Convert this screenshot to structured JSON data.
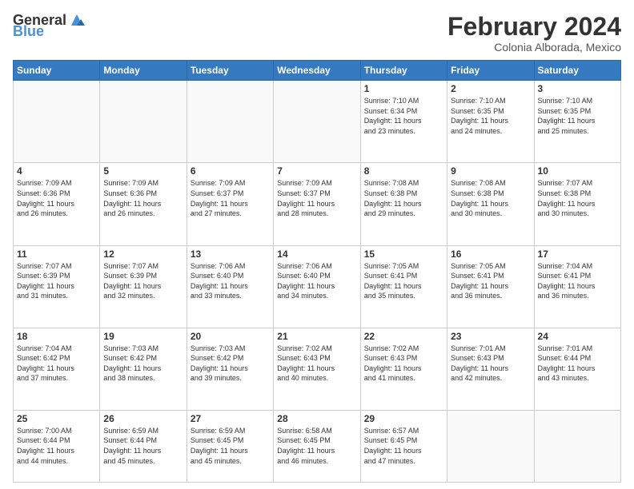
{
  "header": {
    "logo_general": "General",
    "logo_blue": "Blue",
    "month": "February 2024",
    "location": "Colonia Alborada, Mexico"
  },
  "weekdays": [
    "Sunday",
    "Monday",
    "Tuesday",
    "Wednesday",
    "Thursday",
    "Friday",
    "Saturday"
  ],
  "weeks": [
    [
      {
        "day": "",
        "info": ""
      },
      {
        "day": "",
        "info": ""
      },
      {
        "day": "",
        "info": ""
      },
      {
        "day": "",
        "info": ""
      },
      {
        "day": "1",
        "info": "Sunrise: 7:10 AM\nSunset: 6:34 PM\nDaylight: 11 hours\nand 23 minutes."
      },
      {
        "day": "2",
        "info": "Sunrise: 7:10 AM\nSunset: 6:35 PM\nDaylight: 11 hours\nand 24 minutes."
      },
      {
        "day": "3",
        "info": "Sunrise: 7:10 AM\nSunset: 6:35 PM\nDaylight: 11 hours\nand 25 minutes."
      }
    ],
    [
      {
        "day": "4",
        "info": "Sunrise: 7:09 AM\nSunset: 6:36 PM\nDaylight: 11 hours\nand 26 minutes."
      },
      {
        "day": "5",
        "info": "Sunrise: 7:09 AM\nSunset: 6:36 PM\nDaylight: 11 hours\nand 26 minutes."
      },
      {
        "day": "6",
        "info": "Sunrise: 7:09 AM\nSunset: 6:37 PM\nDaylight: 11 hours\nand 27 minutes."
      },
      {
        "day": "7",
        "info": "Sunrise: 7:09 AM\nSunset: 6:37 PM\nDaylight: 11 hours\nand 28 minutes."
      },
      {
        "day": "8",
        "info": "Sunrise: 7:08 AM\nSunset: 6:38 PM\nDaylight: 11 hours\nand 29 minutes."
      },
      {
        "day": "9",
        "info": "Sunrise: 7:08 AM\nSunset: 6:38 PM\nDaylight: 11 hours\nand 30 minutes."
      },
      {
        "day": "10",
        "info": "Sunrise: 7:07 AM\nSunset: 6:38 PM\nDaylight: 11 hours\nand 30 minutes."
      }
    ],
    [
      {
        "day": "11",
        "info": "Sunrise: 7:07 AM\nSunset: 6:39 PM\nDaylight: 11 hours\nand 31 minutes."
      },
      {
        "day": "12",
        "info": "Sunrise: 7:07 AM\nSunset: 6:39 PM\nDaylight: 11 hours\nand 32 minutes."
      },
      {
        "day": "13",
        "info": "Sunrise: 7:06 AM\nSunset: 6:40 PM\nDaylight: 11 hours\nand 33 minutes."
      },
      {
        "day": "14",
        "info": "Sunrise: 7:06 AM\nSunset: 6:40 PM\nDaylight: 11 hours\nand 34 minutes."
      },
      {
        "day": "15",
        "info": "Sunrise: 7:05 AM\nSunset: 6:41 PM\nDaylight: 11 hours\nand 35 minutes."
      },
      {
        "day": "16",
        "info": "Sunrise: 7:05 AM\nSunset: 6:41 PM\nDaylight: 11 hours\nand 36 minutes."
      },
      {
        "day": "17",
        "info": "Sunrise: 7:04 AM\nSunset: 6:41 PM\nDaylight: 11 hours\nand 36 minutes."
      }
    ],
    [
      {
        "day": "18",
        "info": "Sunrise: 7:04 AM\nSunset: 6:42 PM\nDaylight: 11 hours\nand 37 minutes."
      },
      {
        "day": "19",
        "info": "Sunrise: 7:03 AM\nSunset: 6:42 PM\nDaylight: 11 hours\nand 38 minutes."
      },
      {
        "day": "20",
        "info": "Sunrise: 7:03 AM\nSunset: 6:42 PM\nDaylight: 11 hours\nand 39 minutes."
      },
      {
        "day": "21",
        "info": "Sunrise: 7:02 AM\nSunset: 6:43 PM\nDaylight: 11 hours\nand 40 minutes."
      },
      {
        "day": "22",
        "info": "Sunrise: 7:02 AM\nSunset: 6:43 PM\nDaylight: 11 hours\nand 41 minutes."
      },
      {
        "day": "23",
        "info": "Sunrise: 7:01 AM\nSunset: 6:43 PM\nDaylight: 11 hours\nand 42 minutes."
      },
      {
        "day": "24",
        "info": "Sunrise: 7:01 AM\nSunset: 6:44 PM\nDaylight: 11 hours\nand 43 minutes."
      }
    ],
    [
      {
        "day": "25",
        "info": "Sunrise: 7:00 AM\nSunset: 6:44 PM\nDaylight: 11 hours\nand 44 minutes."
      },
      {
        "day": "26",
        "info": "Sunrise: 6:59 AM\nSunset: 6:44 PM\nDaylight: 11 hours\nand 45 minutes."
      },
      {
        "day": "27",
        "info": "Sunrise: 6:59 AM\nSunset: 6:45 PM\nDaylight: 11 hours\nand 45 minutes."
      },
      {
        "day": "28",
        "info": "Sunrise: 6:58 AM\nSunset: 6:45 PM\nDaylight: 11 hours\nand 46 minutes."
      },
      {
        "day": "29",
        "info": "Sunrise: 6:57 AM\nSunset: 6:45 PM\nDaylight: 11 hours\nand 47 minutes."
      },
      {
        "day": "",
        "info": ""
      },
      {
        "day": "",
        "info": ""
      }
    ]
  ]
}
